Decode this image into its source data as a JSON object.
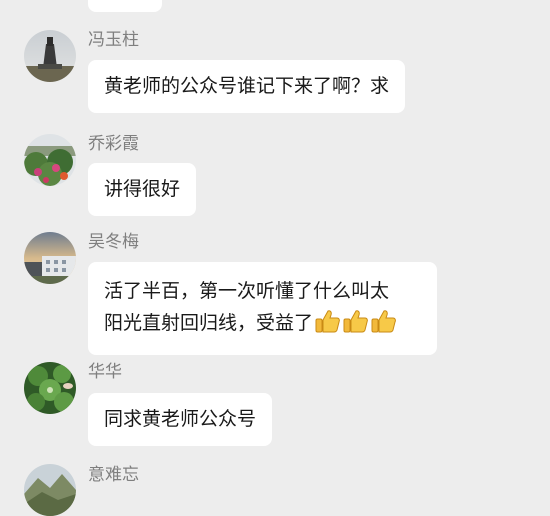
{
  "messages": [
    {
      "name": "冯玉柱",
      "text": "黄老师的公众号谁记下来了啊？求",
      "avatar_icon": "monument-photo-avatar"
    },
    {
      "name": "乔彩霞",
      "text": "讲得很好",
      "avatar_icon": "garden-photo-avatar"
    },
    {
      "name": "吴冬梅",
      "text_line1": "活了半百，第一次听懂了什么叫太",
      "text_line2": "阳光直射回归线，受益了",
      "emoji_icons": [
        "thumbs-up-icon",
        "thumbs-up-icon",
        "thumbs-up-icon"
      ],
      "avatar_icon": "sunset-building-avatar"
    },
    {
      "name": "华华",
      "text": "同求黄老师公众号",
      "avatar_icon": "clover-photo-avatar"
    },
    {
      "name": "意难忘",
      "avatar_icon": "mountain-photo-avatar"
    }
  ],
  "colors": {
    "background": "#ededed",
    "bubble": "#ffffff",
    "name_text": "#7f7f7f",
    "message_text": "#191919"
  }
}
